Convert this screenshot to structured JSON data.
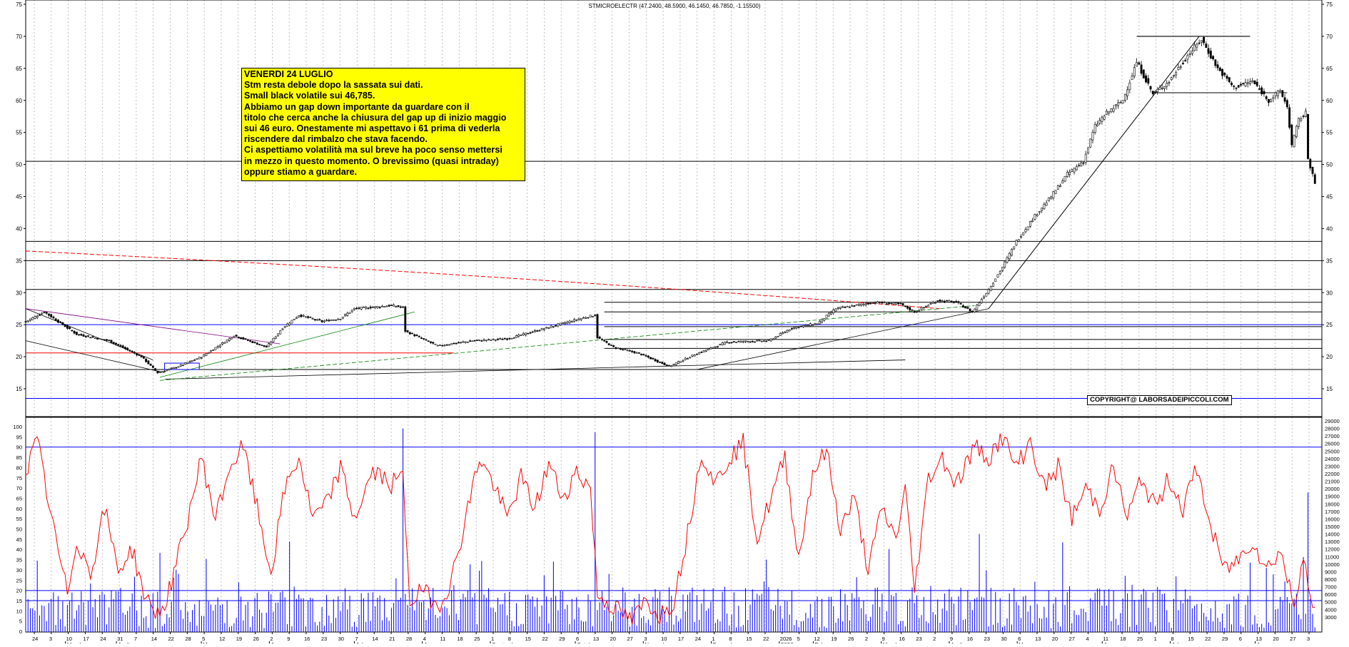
{
  "header": "STMICROELECTR (47.2400, 48.5900, 46.1450, 46.7850, -1.15500)",
  "note": {
    "lines": [
      "VENERDI 24 LUGLIO",
      "Stm resta debole dopo la sassata sui dati.",
      "Small black volatile sui 46,785.",
      "Abbiamo un gap down importante da guardare con il",
      "titolo che cerca anche la chiusura del gap up di inizio maggio",
      "sui 46 euro. Onestamente mi aspettavo i 61 prima di vederla",
      "riscendere dal rimbalzo che stava facendo.",
      "Ci aspettiamo volatilità ma sul breve ha poco senso mettersi",
      "in mezzo in questo momento. O brevissimo (quasi intraday)",
      "oppure stiamo a guardare."
    ]
  },
  "copyright": "COPYRIGHT@ LABORSADEIPICCOLI.COM",
  "colors": {
    "candle": "#000000",
    "oscillator": "#ff0000",
    "volume": "#0000ff",
    "annotation_box": "#ffff00",
    "support_line": "#000000",
    "blue_line": "#0000ff",
    "green_trend": "#008000",
    "red_dashed_ma": "#ff0000",
    "purple_trend": "#800080"
  },
  "chart_data": [
    {
      "type": "candlestick",
      "title": "STMICROELECTR (47.2400, 48.5900, 46.1450, 46.7850, -1.15500)",
      "ylim": [
        10,
        75
      ],
      "yticks": [
        15,
        20,
        25,
        30,
        35,
        40,
        45,
        50,
        55,
        60,
        65,
        70,
        75
      ],
      "horizontal_levels_black": [
        50.5,
        38,
        35,
        30.5,
        28.5,
        27,
        24.7,
        22.7,
        21.3,
        18
      ],
      "horizontal_levels_blue": [
        13.5,
        25
      ],
      "horizontal_levels_red": [
        20.6
      ],
      "resistance_top": 70,
      "anchors": [
        [
          0,
          25.5
        ],
        [
          8,
          27
        ],
        [
          22,
          23.5
        ],
        [
          36,
          22.5
        ],
        [
          50,
          20
        ],
        [
          57,
          17.5
        ],
        [
          66,
          18.5
        ],
        [
          76,
          20
        ],
        [
          90,
          23.3
        ],
        [
          104,
          21.5
        ],
        [
          111,
          24.5
        ],
        [
          118,
          26.5
        ],
        [
          128,
          25.5
        ],
        [
          136,
          26
        ],
        [
          142,
          27.5
        ],
        [
          158,
          28
        ],
        [
          163,
          27.7
        ],
        [
          164,
          24
        ],
        [
          178,
          21.7
        ],
        [
          193,
          22.5
        ],
        [
          208,
          22.8
        ],
        [
          225,
          24.5
        ],
        [
          240,
          26
        ],
        [
          246,
          26.5
        ],
        [
          247,
          23
        ],
        [
          254,
          21.5
        ],
        [
          265,
          20.5
        ],
        [
          278,
          18.5
        ],
        [
          290,
          20.5
        ],
        [
          303,
          22.3
        ],
        [
          321,
          22.5
        ],
        [
          331,
          24.5
        ],
        [
          342,
          25.2
        ],
        [
          350,
          27.5
        ],
        [
          367,
          28.5
        ],
        [
          378,
          28.2
        ],
        [
          384,
          27
        ],
        [
          394,
          28.8
        ],
        [
          402,
          28.5
        ],
        [
          409,
          27
        ],
        [
          416,
          30.5
        ],
        [
          422,
          34
        ],
        [
          428,
          38
        ],
        [
          436,
          42
        ],
        [
          443,
          45
        ],
        [
          450,
          48.5
        ],
        [
          457,
          50.5
        ],
        [
          462,
          56
        ],
        [
          467,
          58
        ],
        [
          474,
          60
        ],
        [
          480,
          66
        ],
        [
          487,
          61
        ],
        [
          494,
          63
        ],
        [
          502,
          67
        ],
        [
          508,
          69.5
        ],
        [
          515,
          65
        ],
        [
          522,
          62
        ],
        [
          530,
          63
        ],
        [
          537,
          60
        ],
        [
          542,
          61.5
        ],
        [
          545,
          59
        ],
        [
          547,
          53
        ],
        [
          550,
          57
        ],
        [
          553,
          58
        ],
        [
          554,
          51
        ],
        [
          556,
          48.5
        ],
        [
          557,
          46.8
        ]
      ],
      "last_ohlc": {
        "open": 47.24,
        "high": 48.59,
        "low": 46.145,
        "close": 46.785,
        "change": -1.155
      },
      "x_tick_labels": [
        "24",
        "3",
        "10",
        "17",
        "24",
        "31",
        "7",
        "14",
        "22",
        "28",
        "5",
        "12",
        "19",
        "26",
        "2",
        "9",
        "16",
        "23",
        "30",
        "7",
        "14",
        "21",
        "28",
        "4",
        "11",
        "18",
        "25",
        "1",
        "8",
        "15",
        "22",
        "29",
        "6",
        "13",
        "20",
        "27",
        "3",
        "10",
        "17",
        "24",
        "1",
        "8",
        "15",
        "22",
        "2026",
        "5",
        "12",
        "19",
        "26",
        "2",
        "9",
        "16",
        "23",
        "2",
        "9",
        "16",
        "23",
        "30",
        "6",
        "13",
        "20",
        "27",
        "4",
        "11",
        "18",
        "25",
        "1",
        "8",
        "15",
        "22",
        "29",
        "6",
        "13",
        "20",
        "27",
        "3"
      ],
      "month_labels": [
        "March",
        "April",
        "May",
        "June",
        "July",
        "August",
        "September",
        "October",
        "November",
        "December",
        "2026",
        "February",
        "March",
        "April",
        "May",
        "June",
        "July",
        "August"
      ]
    },
    {
      "type": "line",
      "name": "oscillator",
      "ylim": [
        0,
        100
      ],
      "yticks": [
        0,
        5,
        10,
        15,
        20,
        25,
        30,
        35,
        40,
        45,
        50,
        55,
        60,
        65,
        70,
        75,
        80,
        85,
        90,
        95,
        100
      ],
      "levels": [
        15,
        90
      ],
      "anchors": [
        [
          0,
          78
        ],
        [
          5,
          93
        ],
        [
          12,
          50
        ],
        [
          18,
          18
        ],
        [
          22,
          45
        ],
        [
          28,
          28
        ],
        [
          34,
          60
        ],
        [
          40,
          30
        ],
        [
          46,
          40
        ],
        [
          52,
          15
        ],
        [
          58,
          8
        ],
        [
          62,
          20
        ],
        [
          68,
          45
        ],
        [
          76,
          85
        ],
        [
          82,
          55
        ],
        [
          88,
          80
        ],
        [
          94,
          90
        ],
        [
          100,
          60
        ],
        [
          106,
          28
        ],
        [
          112,
          70
        ],
        [
          118,
          85
        ],
        [
          124,
          55
        ],
        [
          130,
          62
        ],
        [
          136,
          80
        ],
        [
          142,
          55
        ],
        [
          150,
          78
        ],
        [
          158,
          72
        ],
        [
          163,
          75
        ],
        [
          166,
          15
        ],
        [
          172,
          20
        ],
        [
          178,
          12
        ],
        [
          184,
          25
        ],
        [
          190,
          55
        ],
        [
          196,
          85
        ],
        [
          202,
          72
        ],
        [
          208,
          55
        ],
        [
          214,
          75
        ],
        [
          220,
          60
        ],
        [
          226,
          82
        ],
        [
          232,
          65
        ],
        [
          238,
          78
        ],
        [
          244,
          70
        ],
        [
          247,
          18
        ],
        [
          256,
          10
        ],
        [
          262,
          5
        ],
        [
          268,
          15
        ],
        [
          274,
          8
        ],
        [
          280,
          15
        ],
        [
          286,
          48
        ],
        [
          292,
          88
        ],
        [
          298,
          72
        ],
        [
          304,
          85
        ],
        [
          310,
          92
        ],
        [
          316,
          45
        ],
        [
          322,
          65
        ],
        [
          328,
          85
        ],
        [
          334,
          35
        ],
        [
          340,
          78
        ],
        [
          346,
          88
        ],
        [
          352,
          50
        ],
        [
          358,
          65
        ],
        [
          364,
          30
        ],
        [
          370,
          60
        ],
        [
          376,
          45
        ],
        [
          380,
          70
        ],
        [
          384,
          20
        ],
        [
          390,
          75
        ],
        [
          396,
          85
        ],
        [
          402,
          72
        ],
        [
          410,
          90
        ],
        [
          416,
          85
        ],
        [
          422,
          95
        ],
        [
          428,
          80
        ],
        [
          434,
          93
        ],
        [
          440,
          70
        ],
        [
          446,
          80
        ],
        [
          452,
          55
        ],
        [
          458,
          70
        ],
        [
          464,
          60
        ],
        [
          470,
          80
        ],
        [
          476,
          55
        ],
        [
          482,
          75
        ],
        [
          488,
          60
        ],
        [
          494,
          75
        ],
        [
          500,
          60
        ],
        [
          506,
          80
        ],
        [
          512,
          50
        ],
        [
          518,
          30
        ],
        [
          524,
          35
        ],
        [
          530,
          45
        ],
        [
          536,
          30
        ],
        [
          542,
          40
        ],
        [
          548,
          12
        ],
        [
          552,
          40
        ],
        [
          555,
          15
        ],
        [
          557,
          8
        ]
      ]
    },
    {
      "type": "bar",
      "name": "volume",
      "ylim": [
        1000,
        29000
      ],
      "yticks": [
        3000,
        4000,
        5000,
        6000,
        7000,
        8000,
        9000,
        10000,
        11000,
        12000,
        13000,
        14000,
        15000,
        16000,
        17000,
        18000,
        19000,
        20000,
        21000,
        22000,
        23000,
        24000,
        25000,
        26000,
        27000,
        28000,
        29000
      ],
      "level": 6500,
      "spikes": [
        [
          163,
          28000
        ],
        [
          246,
          27500
        ],
        [
          412,
          14000
        ],
        [
          554,
          19500
        ],
        [
          373,
          12000
        ],
        [
          114,
          13000
        ],
        [
          58,
          11500
        ]
      ]
    }
  ]
}
